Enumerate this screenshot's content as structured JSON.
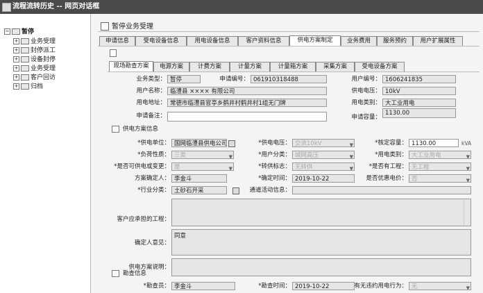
{
  "window": {
    "title": "流程流转历史 -- 网页对话框"
  },
  "tree": {
    "root": "暂停",
    "items": [
      "业务受理",
      "封停派工",
      "设备封停",
      "业务受理",
      "客户回访",
      "归档"
    ]
  },
  "page": {
    "title": "暂停业务受理"
  },
  "tabs1": [
    "申请信息",
    "受电设备信息",
    "用电设备信息",
    "客户资料信息",
    "供电方案制定",
    "业务费用",
    "服务预约",
    "用户扩展属性"
  ],
  "tabs2": [
    "现场勘查方案",
    "电源方案",
    "计费方案",
    "计量方案",
    "计量箱方案",
    "采集方案",
    "受电设备方案"
  ],
  "top": {
    "biz_type_label": "业务类型：",
    "biz_type": "暂停",
    "app_no_label": "申请编号：",
    "app_no": "061910318488",
    "user_no_label": "用户编号：",
    "user_no": "1606241835",
    "user_name_label": "用户名称：",
    "user_name": "临澧县 ×××× 有限公司",
    "voltage_label": "供电电压：",
    "voltage": "10kV",
    "address_label": "用电地址：",
    "address": "常德市临澧县官亭乡鹤井村鹤井村1组无门牌",
    "category_label": "用电类别：",
    "category": "大工业用电",
    "remark_label": "申请备注：",
    "remark": "",
    "capacity_label": "申请容量：",
    "capacity": "1130.00"
  },
  "supply": {
    "section": "供电方案信息",
    "unit_label": "*供电单位：",
    "unit": "国网临澧县供电公司",
    "volt_label": "*供电电压：",
    "volt": "交流10kV",
    "cap_label": "*核定容量：",
    "cap": "1130.00",
    "cap_unit": "kVA",
    "load_label": "*负荷性质：",
    "load": "三类",
    "ucls_label": "*用户分类：",
    "ucls": "城网高压",
    "ucat_label": "*用电类别：",
    "ucat": "大工业用电",
    "change_label": "*是否可供电或变更：",
    "change": "是",
    "trans_label": "*转供标志：",
    "trans": "无转供",
    "works_label": "*是否有工程：",
    "works": "无工程",
    "confirmer_label": "方案确定人：",
    "confirmer": "李金斗",
    "date_label": "*确定时间：",
    "date": "2019-10-22",
    "prefer_label": "是否优惠电价：",
    "prefer": "否",
    "industry_label": "*行业分类：",
    "industry": "土砂石开采",
    "activity_label": "通道活动信息：",
    "activity": "",
    "proj_label": "客户应承担的工程：",
    "proj": "",
    "opinion_label": "确定人意见：",
    "opinion": "同意",
    "desc_label": "供电方案说明：",
    "desc": ""
  },
  "survey": {
    "section": "勘查信息",
    "surveyor_label": "*勘查员：",
    "surveyor": "李金斗",
    "stime_label": "*勘查时间：",
    "stime": "2019-10-22",
    "illegal_label": "有无违约用电行为：",
    "illegal": "无"
  }
}
